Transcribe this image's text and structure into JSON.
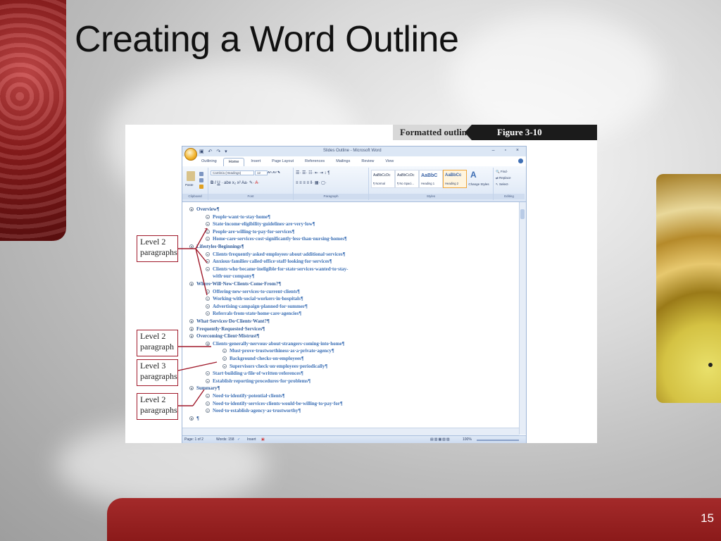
{
  "slide": {
    "title": "Creating a Word Outline",
    "page_number": "15"
  },
  "figure": {
    "caption": "Formatted outline",
    "number": "Figure 3-10"
  },
  "word": {
    "window_title": "Slides Outline - Microsoft Word",
    "tabs": [
      "Outlining",
      "Home",
      "Insert",
      "Page Layout",
      "References",
      "Mailings",
      "Review",
      "View"
    ],
    "active_tab": "Home",
    "ribbon": {
      "clipboard": {
        "label": "Clipboard",
        "paste": "Paste"
      },
      "font": {
        "label": "Font",
        "font_name": "Cambria (Headings)",
        "font_size": "12"
      },
      "paragraph": {
        "label": "Paragraph"
      },
      "styles": {
        "label": "Styles",
        "items": [
          {
            "sample": "AaBbCcDc",
            "name": "¶ Normal"
          },
          {
            "sample": "AaBbCcDc",
            "name": "¶ No Spaci..."
          },
          {
            "sample": "AaBbC",
            "name": "Heading 1"
          },
          {
            "sample": "AaBbCc",
            "name": "Heading 2"
          }
        ],
        "change_styles": "Change Styles"
      },
      "editing": {
        "label": "Editing",
        "find": "Find",
        "replace": "Replace",
        "select": "Select"
      }
    },
    "status": {
      "page": "Page: 1 of 2",
      "words": "Words: 158",
      "mode": "Insert",
      "zoom": "100%"
    },
    "outline": [
      {
        "level": 1,
        "text": "Overview¶"
      },
      {
        "level": 2,
        "text": "People·want·to·stay·home¶"
      },
      {
        "level": 2,
        "text": "State·income·eligibility·guidelines·are·very·low¶"
      },
      {
        "level": 2,
        "text": "People·are·willing·to·pay·for·services¶"
      },
      {
        "level": 2,
        "text": "Home·care·services·cost·significantly·less·than·nursing·homes¶"
      },
      {
        "level": 1,
        "text": "Lifestyles·Beginnings¶"
      },
      {
        "level": 2,
        "text": "Clients·frequently·asked·employees·about·additional·services¶"
      },
      {
        "level": 2,
        "text": "Anxious·families·called·office·staff·looking·for·services¶"
      },
      {
        "level": 2,
        "text": "Clients·who·became·ineligible·for·state·services·wanted·to·stay-"
      },
      {
        "level": 2,
        "text": "with·our·company¶",
        "continuation": true
      },
      {
        "level": 1,
        "text": "Where·Will·New·Clients·Come·From?¶"
      },
      {
        "level": 2,
        "text": "Offering·new·services·to·current·clients¶"
      },
      {
        "level": 2,
        "text": "Working·with·social·workers·in·hospitals¶"
      },
      {
        "level": 2,
        "text": "Advertising·campaign·planned·for·summer¶"
      },
      {
        "level": 2,
        "text": "Referrals·from·state·home·care·agencies¶"
      },
      {
        "level": 1,
        "text": "What·Services·Do·Clients·Want?¶"
      },
      {
        "level": 1,
        "text": "Frequently·Requested·Services¶"
      },
      {
        "level": 1,
        "text": "Overcoming·Client·Mistrust¶"
      },
      {
        "level": 2,
        "text": "Clients·generally·nervous·about·strangers·coming·into·home¶"
      },
      {
        "level": 3,
        "text": "Must·prove·trustworthiness·as·a·private·agency¶"
      },
      {
        "level": 3,
        "text": "Background·checks·on·employees¶"
      },
      {
        "level": 3,
        "text": "Supervisors·check·on·employees·periodically¶"
      },
      {
        "level": 2,
        "text": "Start·building·a·file·of·written·references¶"
      },
      {
        "level": 2,
        "text": "Establish·reporting·procedures·for·problems¶"
      },
      {
        "level": 1,
        "text": "Summary¶"
      },
      {
        "level": 2,
        "text": "Need·to·identify·potential·clients¶"
      },
      {
        "level": 2,
        "text": "Need·to·identify·services·clients·would·be·willing·to·pay·for¶"
      },
      {
        "level": 2,
        "text": "Need·to·establish·agency·as·trustworthy¶"
      },
      {
        "level": 1,
        "text": "¶"
      }
    ],
    "callouts": [
      {
        "text": "Level 2 paragraphs"
      },
      {
        "text": "Level 2 paragraph"
      },
      {
        "text": "Level 3 paragraphs"
      },
      {
        "text": "Level 2 paragraphs"
      }
    ]
  }
}
